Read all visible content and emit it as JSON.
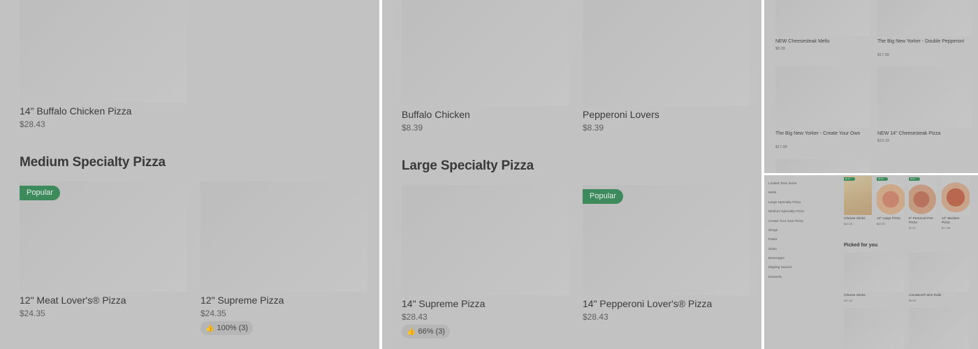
{
  "colors": {
    "overlay_gray": "#c2c2c2",
    "popular_badge": "#3d8a5d",
    "text_primary": "#3a3a3a"
  },
  "panel_a": {
    "top_item": {
      "name": "14\" Buffalo Chicken Pizza",
      "price": "$28.43"
    },
    "section_title": "Medium Specialty Pizza",
    "items": [
      {
        "name": "12\" Meat Lover's® Pizza",
        "price": "$24.35",
        "badge": "Popular"
      },
      {
        "name": "12\" Supreme Pizza",
        "price": "$24.35",
        "rating_icon": "thumbs-up-icon",
        "rating": "100% (3)"
      }
    ]
  },
  "panel_b": {
    "top_items": [
      {
        "name": "Buffalo Chicken",
        "price": "$8.39"
      },
      {
        "name": "Pepperoni Lovers",
        "price": "$8.39"
      }
    ],
    "section_title": "Large Specialty Pizza",
    "items": [
      {
        "name": "14\" Supreme Pizza",
        "price": "$28.43",
        "rating_icon": "thumbs-up-icon",
        "rating": "66% (3)"
      },
      {
        "name": "14\" Pepperoni Lover's® Pizza",
        "price": "$28.43",
        "badge": "Popular"
      }
    ]
  },
  "panel_c": {
    "items": [
      {
        "name": "NEW Cheesesteak Melts",
        "price": "$8.39"
      },
      {
        "name": "The Big New Yorker - Double Pepperoni",
        "price": "$17.99"
      },
      {
        "name": "The Big New Yorker - Create Your Own",
        "price": "$17.99"
      },
      {
        "name": "NEW 14\" Cheesesteak Pizza",
        "price": "$19.19"
      }
    ]
  },
  "panel_d": {
    "categories": [
      "Limited Time Items",
      "Melts",
      "Large Specialty Pizza",
      "Medium Specialty Pizza",
      "Create Your Own Pizza",
      "Wings",
      "Pasta",
      "Sides",
      "Beverages",
      "Dipping Sauces",
      "Desserts"
    ],
    "top_items": [
      {
        "name": "Cheese Sticks",
        "price": "$10.43",
        "badge": "#1 M..."
      },
      {
        "name": "14\" Large Pizza",
        "price": "$20.87",
        "badge": "#2 M..."
      },
      {
        "name": "6\" Personal Pan Pizza",
        "price": "$7.67",
        "badge": "#3 M..."
      },
      {
        "name": "12\" Medium Pizza",
        "price": "$17.99"
      }
    ],
    "picked_title": "Picked for you",
    "picked_items": [
      {
        "name": "Cheese Sticks",
        "price": "$10.43"
      },
      {
        "name": "Cinnabon® Mini Rolls",
        "price": "$9.59"
      }
    ]
  }
}
